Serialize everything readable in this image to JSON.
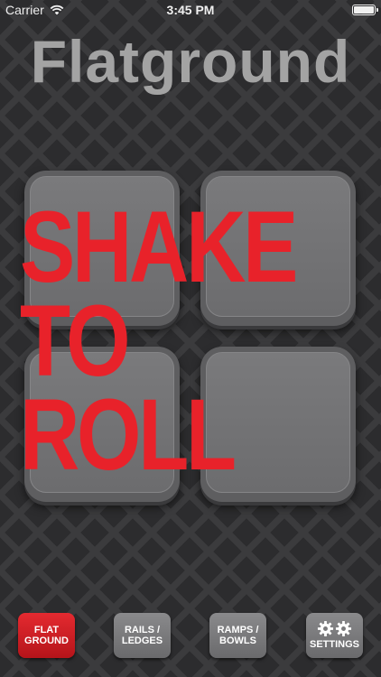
{
  "status_bar": {
    "carrier": "Carrier",
    "time": "3:45 PM",
    "battery_level": 1.0
  },
  "app": {
    "title": "Flatground"
  },
  "main": {
    "shake_lines": [
      "SHAKE",
      "TO",
      "ROLL"
    ],
    "accent_color": "#e8222a"
  },
  "nav": {
    "items": [
      {
        "line1": "FLAT",
        "line2": "GROUND",
        "active": true
      },
      {
        "line1": "RAILS /",
        "line2": "LEDGES",
        "active": false
      },
      {
        "line1": "RAMPS /",
        "line2": "BOWLS",
        "active": false
      },
      {
        "line1": "SETTINGS",
        "icon": "gear-icon",
        "active": false
      }
    ]
  }
}
